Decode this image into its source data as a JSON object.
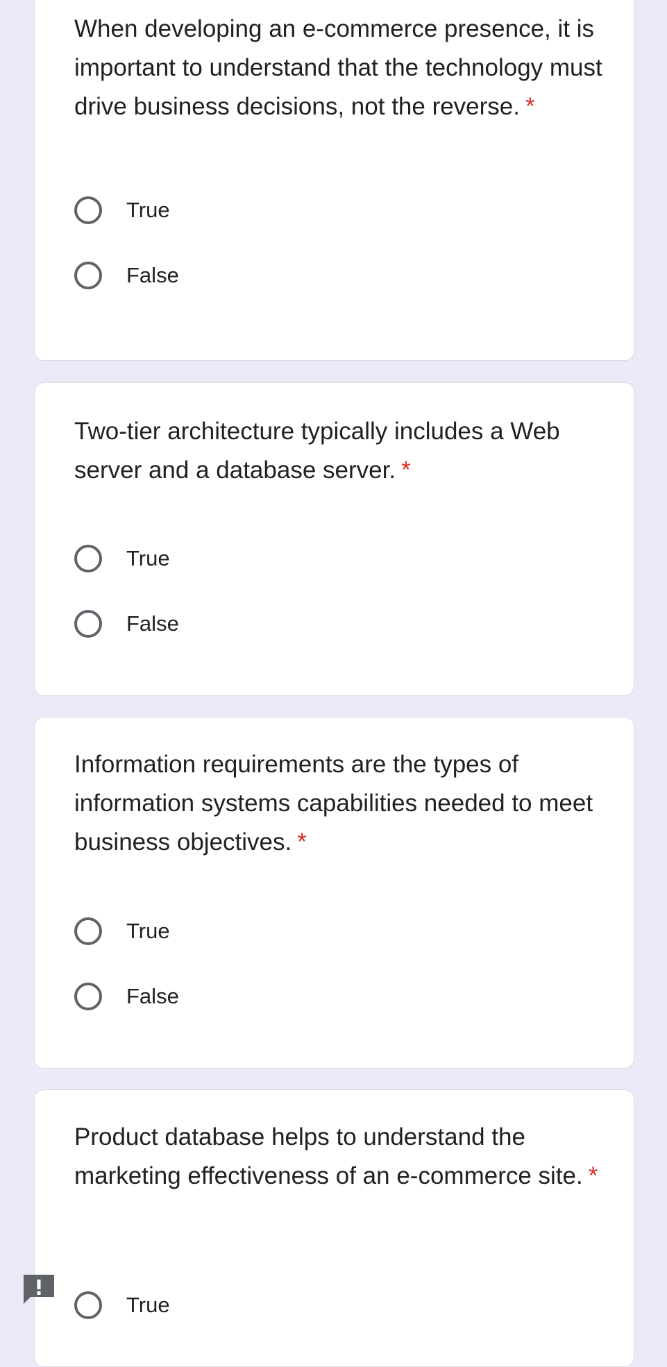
{
  "questions": [
    {
      "text": "When developing an e-commerce presence, it is important to understand that the technology must drive business decisions, not the reverse.",
      "required_mark": "*",
      "options": [
        "True",
        "False"
      ]
    },
    {
      "text": "Two-tier architecture typically includes a Web server and a database server.",
      "required_mark": "*",
      "options": [
        "True",
        "False"
      ]
    },
    {
      "text": "Information requirements are the types of information systems capabilities needed to meet business objectives.",
      "required_mark": "*",
      "options": [
        "True",
        "False"
      ]
    },
    {
      "text": "Product database helps to understand the marketing effectiveness of an e-commerce site.",
      "required_mark": "*",
      "options": [
        "True"
      ]
    }
  ],
  "icons": {
    "feedback": "report-feedback-icon"
  },
  "colors": {
    "page_background": "#ECE9F8",
    "card_background": "#FFFFFF",
    "required_asterisk": "#D93025",
    "radio_border": "#5F6368"
  }
}
